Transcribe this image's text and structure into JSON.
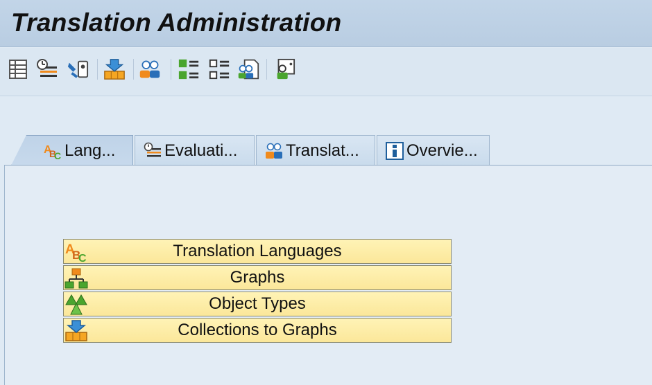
{
  "window": {
    "title": "Translation Administration"
  },
  "toolbar": {
    "buttons": [
      {
        "icon": "list-icon"
      },
      {
        "icon": "evaluation-icon"
      },
      {
        "icon": "tools-icon"
      },
      {
        "icon": "collection-icon"
      },
      {
        "icon": "users-icon"
      },
      {
        "icon": "object-list-icon"
      },
      {
        "icon": "object-list-empty-icon"
      },
      {
        "icon": "document-users-icon"
      },
      {
        "icon": "user-settings-icon"
      }
    ]
  },
  "tabs": [
    {
      "label": "Lang...",
      "icon": "languages-icon",
      "active": true
    },
    {
      "label": "Evaluati...",
      "icon": "evaluation-icon",
      "active": false
    },
    {
      "label": "Translat...",
      "icon": "users-icon",
      "active": false
    },
    {
      "label": "Overvie...",
      "icon": "info-icon",
      "active": false
    }
  ],
  "panel": {
    "buttons": [
      {
        "label": "Translation Languages",
        "icon": "languages-icon"
      },
      {
        "label": "Graphs",
        "icon": "hierarchy-icon"
      },
      {
        "label": "Object Types",
        "icon": "object-types-icon"
      },
      {
        "label": "Collections to Graphs",
        "icon": "collection-icon"
      }
    ]
  },
  "colors": {
    "accent_orange": "#f08a1c",
    "accent_green": "#4aa52e",
    "accent_blue": "#2a6fb8",
    "button_yellow": "#fbe9a0"
  }
}
